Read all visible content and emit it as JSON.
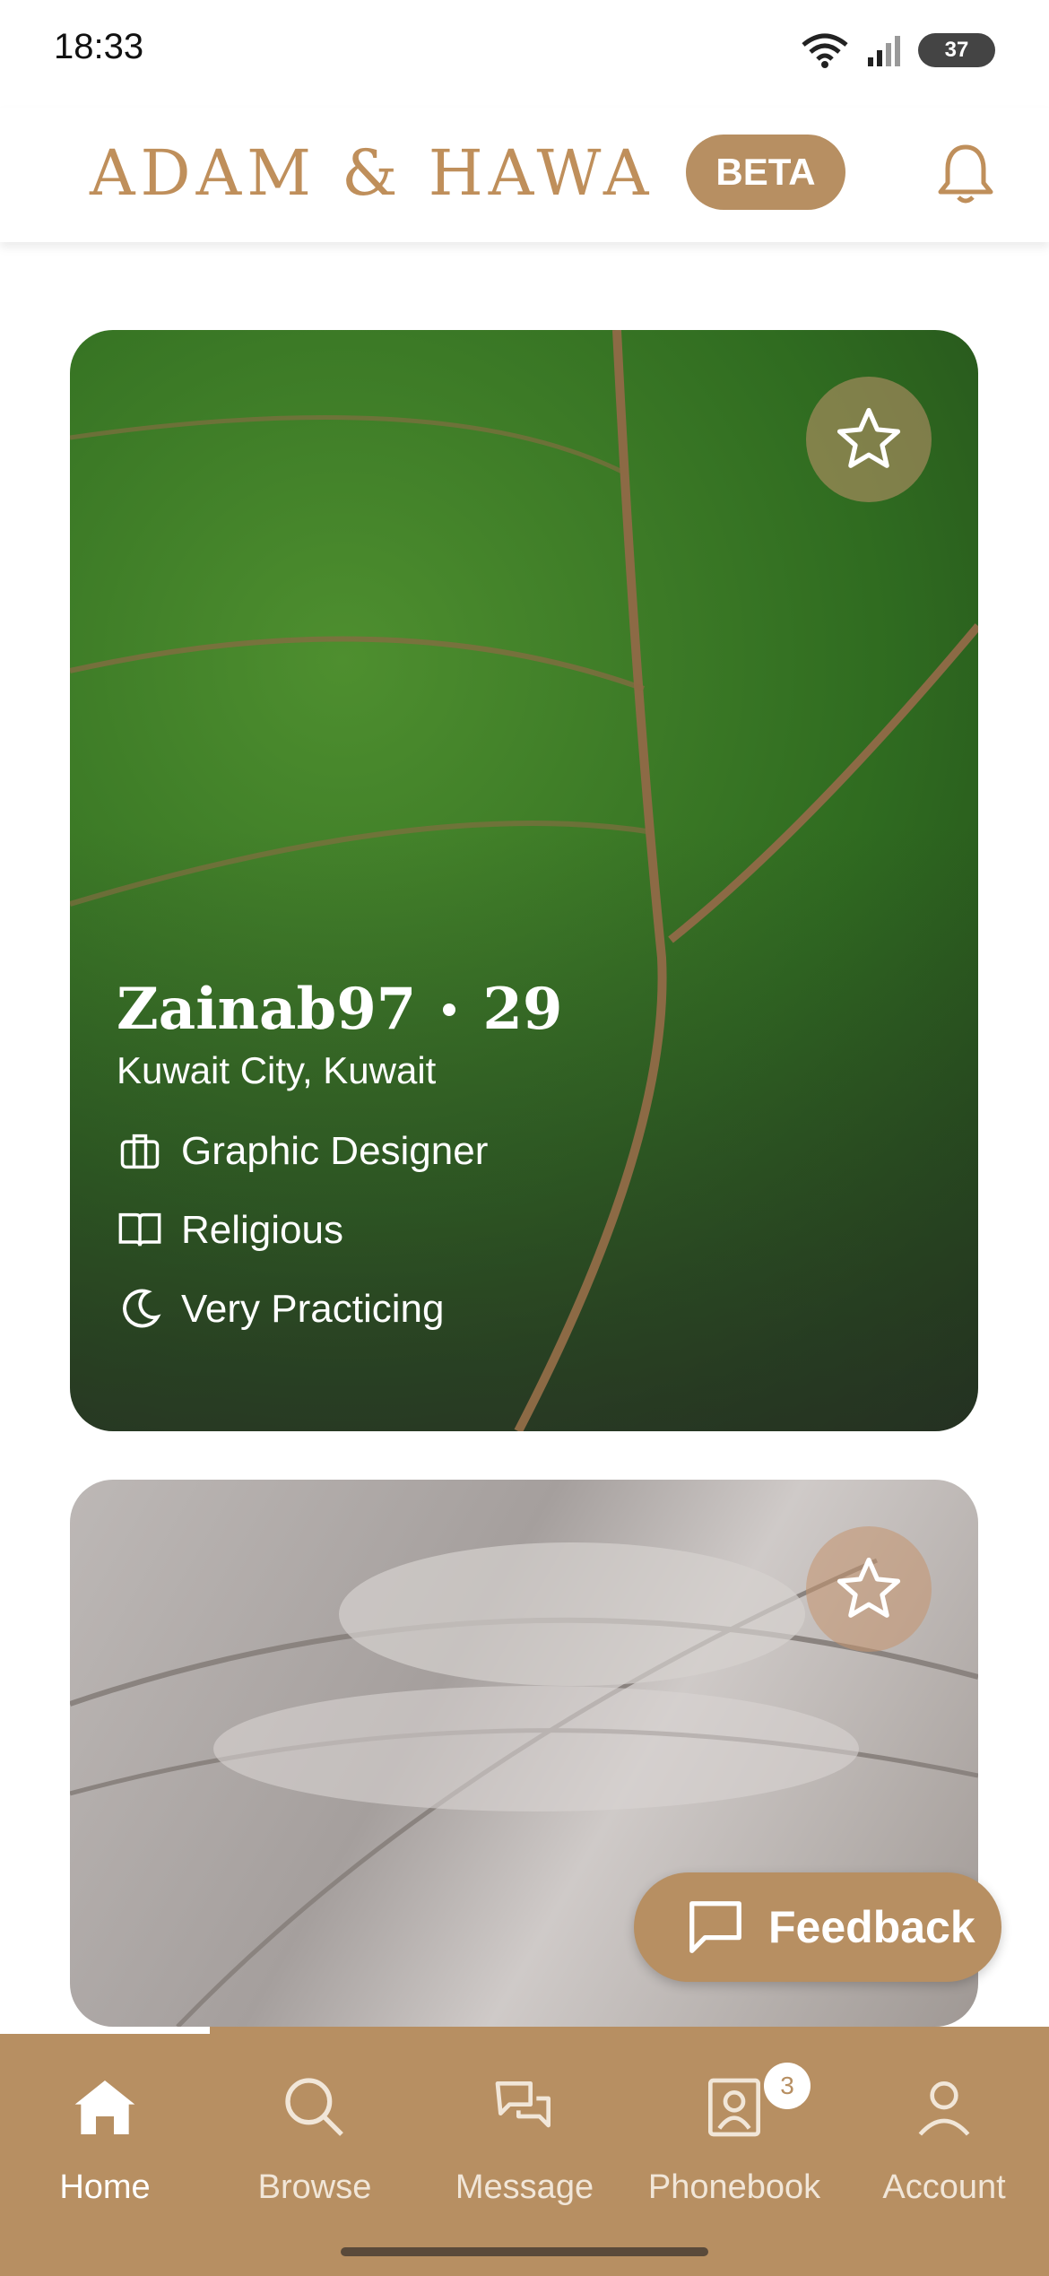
{
  "status_bar": {
    "time": "18:33",
    "battery": "37"
  },
  "header": {
    "brand": "ADAM & HAWA",
    "beta": "BETA"
  },
  "profile": {
    "username": "Zainab97",
    "age": "29",
    "location": "Kuwait City, Kuwait",
    "profession": "Graphic Designer",
    "religiousness": "Religious",
    "practice": "Very Practicing"
  },
  "feedback_label": "Feedback",
  "nav": {
    "home": "Home",
    "browse": "Browse",
    "message": "Message",
    "phonebook": "Phonebook",
    "phonebook_badge": "3",
    "account": "Account"
  },
  "colors": {
    "accent": "#b78f62",
    "brand_text": "#bf8f5b"
  }
}
